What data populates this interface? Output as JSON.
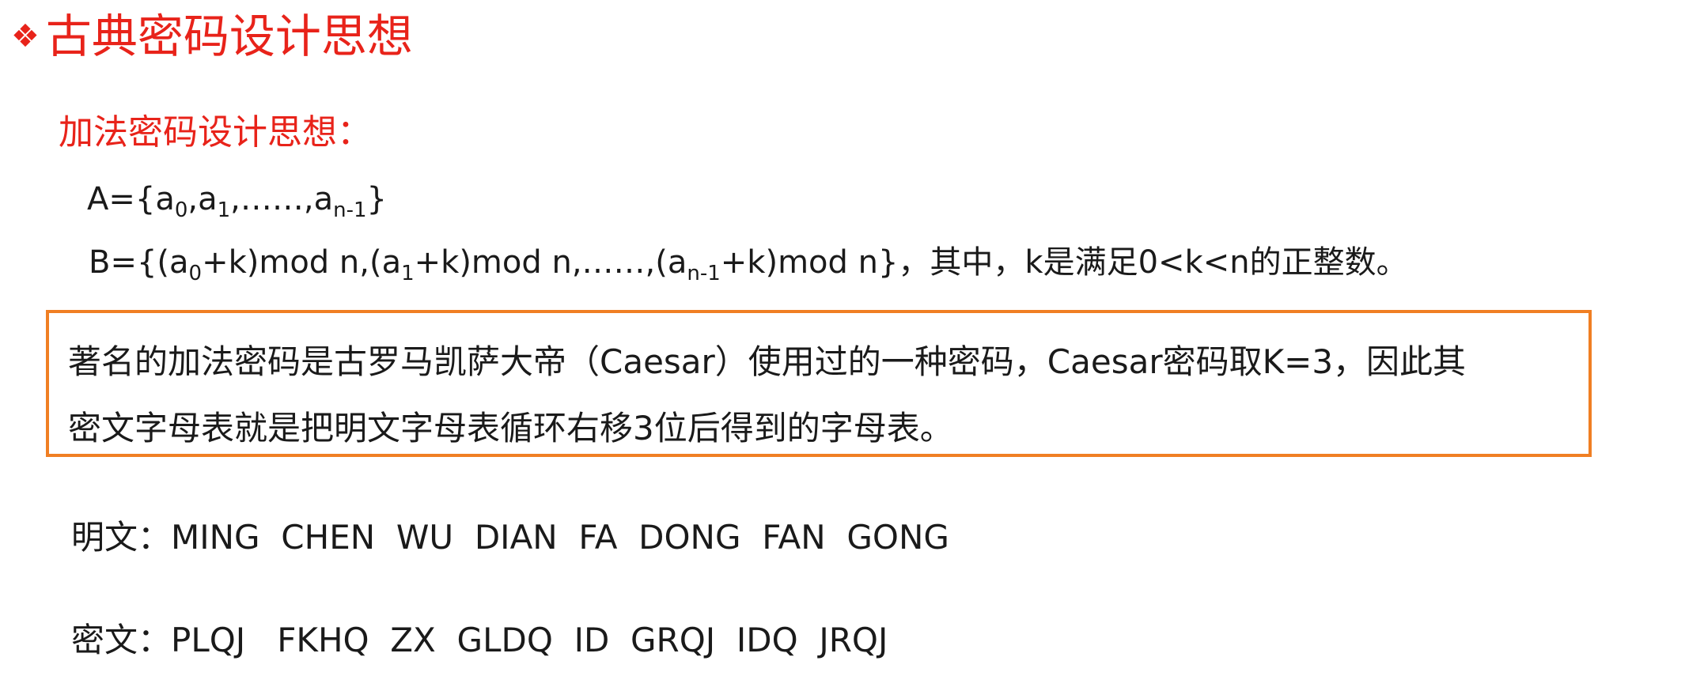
{
  "heading": {
    "bullet": "❖",
    "title": "古典密码设计思想"
  },
  "subtitle": "加法密码设计思想：",
  "formula_a": {
    "prefix": "A={a",
    "sub0": "0",
    "mid1": ",a",
    "sub1": "1",
    "mid2": ",……,a",
    "sub2": "n-1",
    "suffix": "}"
  },
  "formula_b": {
    "prefix": "B={(a",
    "sub0": "0",
    "mid1": "+k)mod n,(a",
    "sub1": "1",
    "mid2": "+k)mod n,……,(a",
    "sub2": "n-1",
    "suffix": "+k)mod n}，其中，k是满足0<k<n的正整数。"
  },
  "callout": {
    "line1": "著名的加法密码是古罗马凯萨大帝（Caesar）使用过的一种密码，Caesar密码取K=3，因此其",
    "line2": "密文字母表就是把明文字母表循环右移3位后得到的字母表。"
  },
  "plaintext": {
    "label": "明文：",
    "value": "MING  CHEN  WU  DIAN  FA  DONG  FAN  GONG"
  },
  "ciphertext": {
    "label": "密文：",
    "value": "PLQJ   FKHQ  ZX  GLDQ  ID  GRQJ  IDQ  JRQJ"
  },
  "colors": {
    "accent_red": "#e8231a",
    "callout_border": "#f07f23",
    "text": "#1a1a1a"
  }
}
